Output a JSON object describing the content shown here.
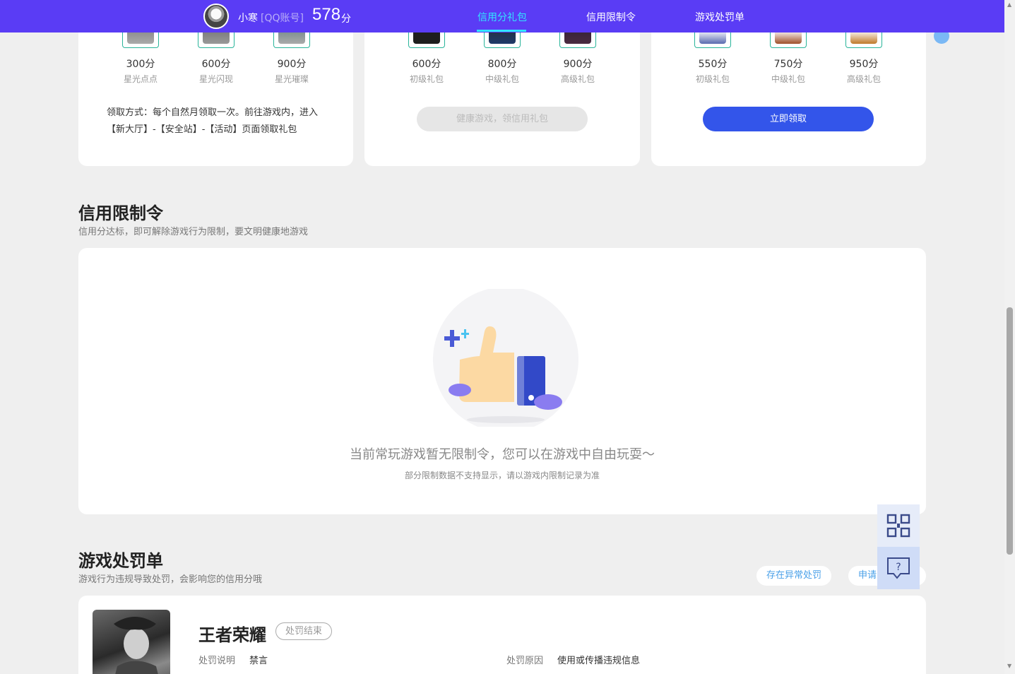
{
  "header": {
    "username": "小寒",
    "account_type": "[QQ账号]",
    "score": "578",
    "score_unit": "分",
    "nav": [
      {
        "label": "信用分礼包",
        "active": true
      },
      {
        "label": "信用限制令",
        "active": false
      },
      {
        "label": "游戏处罚单",
        "active": false
      }
    ]
  },
  "gift_cards": [
    {
      "items": [
        {
          "points": "300分",
          "label": "星光点点"
        },
        {
          "points": "600分",
          "label": "星光闪现"
        },
        {
          "points": "900分",
          "label": "星光璀璨"
        }
      ],
      "howto": "领取方式：每个自然月领取一次。前往游戏内，进入【新大厅】-【安全站】-【活动】页面领取礼包"
    },
    {
      "items": [
        {
          "points": "600分",
          "label": "初级礼包"
        },
        {
          "points": "800分",
          "label": "中级礼包"
        },
        {
          "points": "900分",
          "label": "高级礼包"
        }
      ],
      "button": "健康游戏，领信用礼包"
    },
    {
      "items": [
        {
          "points": "550分",
          "label": "初级礼包"
        },
        {
          "points": "750分",
          "label": "中级礼包"
        },
        {
          "points": "950分",
          "label": "高级礼包"
        }
      ],
      "button": "立即领取"
    }
  ],
  "restriction": {
    "title": "信用限制令",
    "subtitle": "信用分达标，即可解除游戏行为限制，要文明健康地游戏",
    "empty_main": "当前常玩游戏暂无限制令，您可以在游戏中自由玩耍～",
    "empty_sub": "部分限制数据不支持显示，请以游戏内限制记录为准"
  },
  "penalty": {
    "title": "游戏处罚单",
    "subtitle": "游戏行为违规导致处罚，会影响您的信用分哦",
    "btn_abnormal": "存在异常处罚",
    "btn_apply": "申请",
    "game_name": "王者荣耀",
    "status": "处罚结束",
    "desc_label": "处罚说明",
    "desc_value": "禁言",
    "reason_label": "处罚原因",
    "reason_value": "使用或传播违规信息"
  }
}
